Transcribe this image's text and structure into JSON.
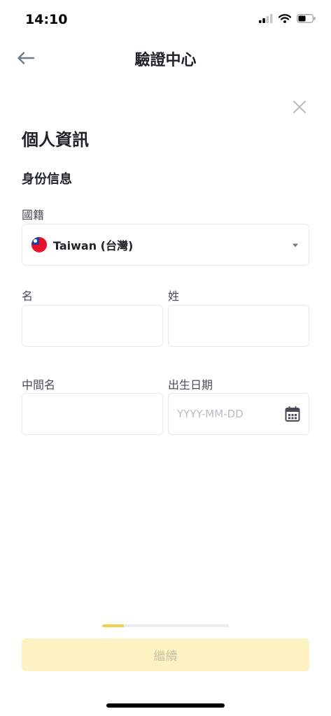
{
  "status_bar": {
    "time": "14:10"
  },
  "nav": {
    "title": "驗證中心"
  },
  "page": {
    "title": "個人資訊",
    "section": "身份信息"
  },
  "form": {
    "nationality_label": "國籍",
    "nationality_value": "Taiwan (台灣)",
    "first_name_label": "名",
    "last_name_label": "姓",
    "middle_name_label": "中間名",
    "birthdate_label": "出生日期",
    "birthdate_placeholder": "YYYY-MM-DD"
  },
  "progress": {
    "fraction": 0.17
  },
  "footer": {
    "continue_label": "繼續"
  },
  "colors": {
    "accent": "#F0B90B",
    "button_disabled_bg": "#FDF3C2",
    "progress_fill": "#F0D24A"
  },
  "icons": [
    "back-arrow-icon",
    "close-icon",
    "chevron-down-icon",
    "calendar-icon",
    "taiwan-flag-icon"
  ]
}
